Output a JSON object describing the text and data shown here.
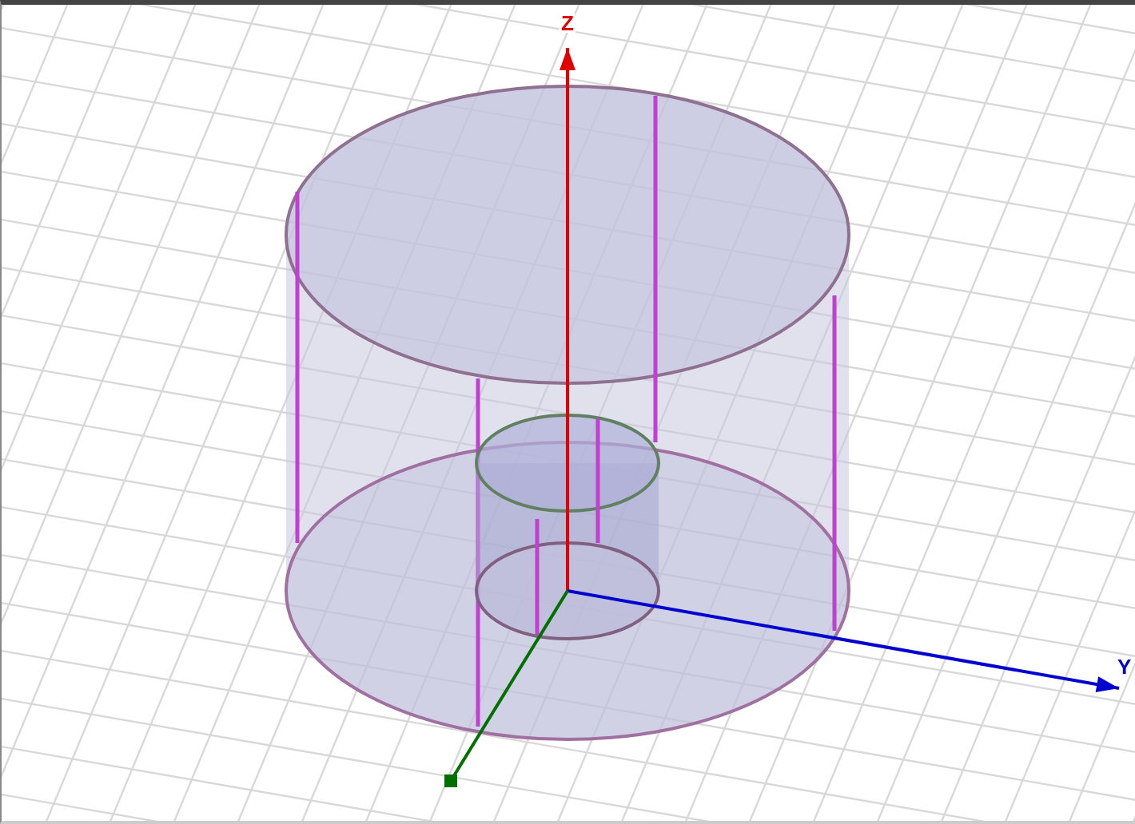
{
  "viewport": {
    "axes": [
      {
        "kind": "z",
        "label": "Z",
        "color": "#e00000"
      },
      {
        "kind": "y",
        "label": "Y",
        "color": "#0000d0"
      },
      {
        "kind": "x",
        "color": "#007000"
      }
    ]
  }
}
